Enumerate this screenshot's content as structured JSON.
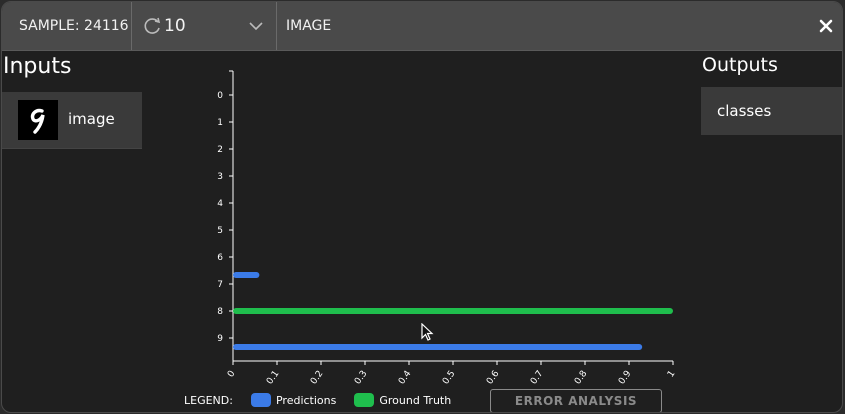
{
  "topbar": {
    "sample_label": "SAMPLE: 24116",
    "cycle_value": "10",
    "title": "IMAGE",
    "close_icon": "close-icon",
    "cycle_icon": "refresh-icon",
    "dropdown_icon": "chevron-down-icon"
  },
  "inputs": {
    "title": "Inputs",
    "items": [
      {
        "label": "image",
        "thumbnail_glyph": "9"
      }
    ]
  },
  "outputs": {
    "title": "Outputs",
    "items": [
      {
        "label": "classes"
      }
    ]
  },
  "legend": {
    "title": "LEGEND:",
    "predictions": "Predictions",
    "ground_truth": "Ground Truth"
  },
  "error_button": "ERROR ANALYSIS",
  "colors": {
    "predictions": "#3b7be8",
    "ground_truth": "#1fbe4d",
    "background": "#1f1f1f",
    "panel": "#3a3a3a"
  },
  "chart_data": {
    "type": "bar",
    "orientation": "horizontal",
    "categories": [
      "0",
      "1",
      "2",
      "3",
      "4",
      "5",
      "6",
      "7",
      "8",
      "9"
    ],
    "x_ticks": [
      "0",
      "0.1",
      "0.2",
      "0.3",
      "0.4",
      "0.5",
      "0.6",
      "0.7",
      "0.8",
      "0.9",
      "1"
    ],
    "xlim": [
      0,
      1
    ],
    "series": [
      {
        "name": "Predictions",
        "color": "#3b7be8",
        "values": [
          0,
          0,
          0,
          0,
          0,
          0,
          0,
          0.06,
          0,
          0.93
        ]
      },
      {
        "name": "Ground Truth",
        "color": "#1fbe4d",
        "values": [
          0,
          0,
          0,
          0,
          0,
          0,
          0,
          0,
          1,
          0
        ]
      }
    ],
    "legend_position": "bottom",
    "grid": false
  }
}
